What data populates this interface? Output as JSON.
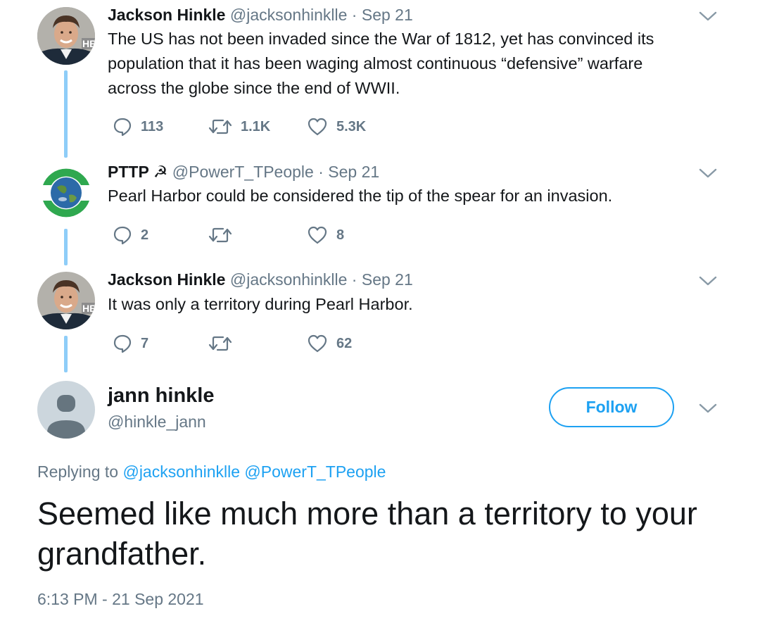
{
  "tweets": [
    {
      "name": "Jackson Hinkle",
      "handle": "@jacksonhinklle",
      "date": "Sep 21",
      "text": "The US has not been invaded since the War of 1812, yet has convinced its population that it has been waging almost continuous “defensive” warfare across the globe since the end of WWII.",
      "avatar_badge": "HB",
      "replies": "113",
      "retweets": "1.1K",
      "likes": "5.3K"
    },
    {
      "name": "PTTP ☭",
      "handle": "@PowerT_TPeople",
      "date": "Sep 21",
      "text": "Pearl Harbor could be considered the tip of the spear for an invasion.",
      "replies": "2",
      "retweets": "",
      "likes": "8"
    },
    {
      "name": "Jackson Hinkle",
      "handle": "@jacksonhinklle",
      "date": "Sep 21",
      "text": "It was only a territory during Pearl Harbor.",
      "avatar_badge": "HB",
      "replies": "7",
      "retweets": "",
      "likes": "62"
    }
  ],
  "main_tweet": {
    "name": "jann hinkle",
    "handle": "@hinkle_jann",
    "follow_label": "Follow",
    "replying_prefix": "Replying to",
    "replying_to": [
      "@jacksonhinklle",
      "@PowerT_TPeople"
    ],
    "text": "Seemed like much more than a territory to your grandfather.",
    "timestamp": "6:13 PM - 21 Sep 2021"
  },
  "colors": {
    "accent": "#1da1f2",
    "thread_line": "#8ecdf8",
    "secondary_text": "#657786",
    "primary_text": "#14171a"
  },
  "icons": {
    "reply": "speech-bubble-icon",
    "retweet": "retweet-arrows-icon",
    "like": "heart-outline-icon",
    "menu": "chevron-down-icon",
    "default_avatar": "person-silhouette-icon",
    "pttp_avatar": "globe-logo-icon"
  }
}
